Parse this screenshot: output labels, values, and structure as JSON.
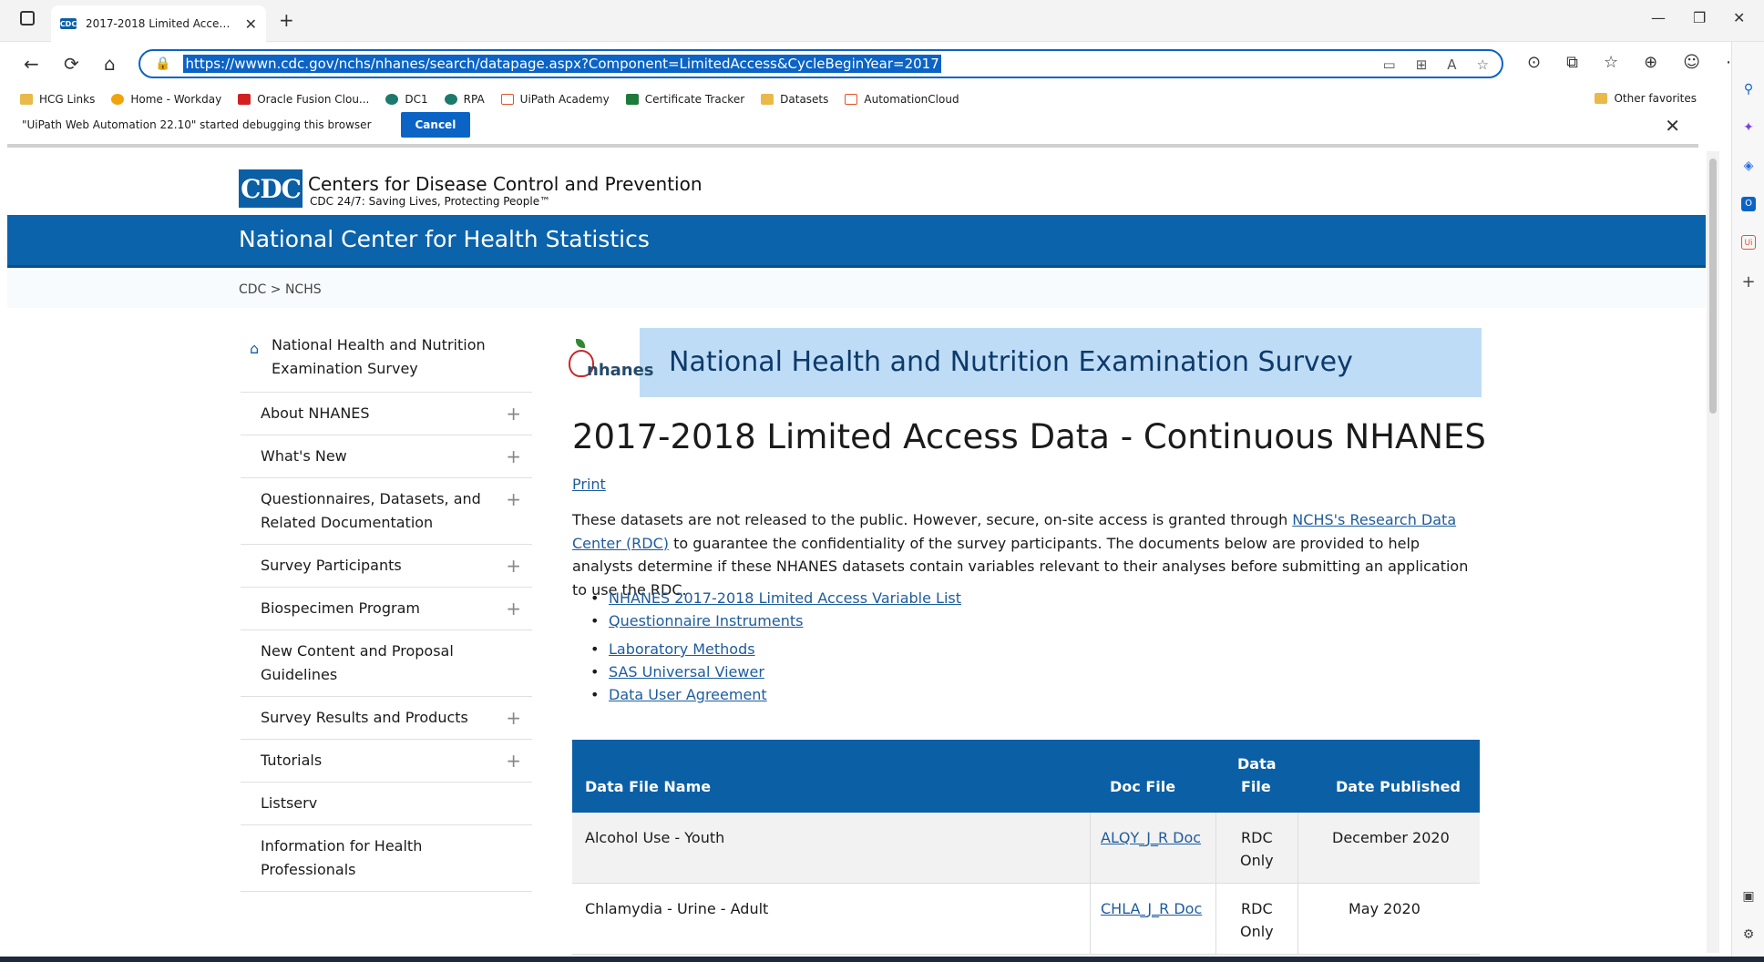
{
  "browser": {
    "tab_title": "2017-2018 Limited Access Data",
    "tab_favicon_text": "CDC",
    "url": "https://wwwn.cdc.gov/nchs/nhanes/search/datapage.aspx?Component=LimitedAccess&CycleBeginYear=2017",
    "favorites": [
      "HCG Links",
      "Home - Workday",
      "Oracle Fusion Clou...",
      "DC1",
      "RPA",
      "UiPath Academy",
      "Certificate Tracker",
      "Datasets",
      "AutomationCloud"
    ],
    "other_favorites": "Other favorites",
    "debug_message": "\"UiPath Web Automation 22.10\" started debugging this browser",
    "debug_cancel": "Cancel"
  },
  "site": {
    "logo_text": "CDC",
    "org_name": "Centers for Disease Control and Prevention",
    "tagline": "CDC 24/7: Saving Lives, Protecting People™",
    "banner_title": "National Center for Health Statistics",
    "breadcrumb": "CDC > NCHS"
  },
  "sidebar": {
    "top": "National Health and Nutrition Examination Survey",
    "items": [
      {
        "label": "About NHANES",
        "plus": "+"
      },
      {
        "label": "What's New",
        "plus": "+"
      },
      {
        "label": "Questionnaires, Datasets, and Related Documentation",
        "plus": "+"
      },
      {
        "label": "Survey Participants",
        "plus": "+"
      },
      {
        "label": "Biospecimen Program",
        "plus": "+"
      },
      {
        "label": "New Content and Proposal Guidelines",
        "plus": ""
      },
      {
        "label": "Survey Results and Products",
        "plus": "+"
      },
      {
        "label": "Tutorials",
        "plus": "+"
      },
      {
        "label": "Listserv",
        "plus": ""
      },
      {
        "label": "Information for Health Professionals",
        "plus": ""
      }
    ]
  },
  "nhanes": {
    "logo_text": "nhanes",
    "banner_title": "National Health and Nutrition Examination Survey"
  },
  "main": {
    "title": "2017-2018 Limited Access Data - Continuous NHANES",
    "print": "Print",
    "desc_before": "These datasets are not released to the public. However, secure, on-site access is granted through ",
    "desc_link": "NCHS's Research Data Center (RDC)",
    "desc_after": " to guarantee the confidentiality of the survey participants. The documents below are provided to help analysts determine if these NHANES datasets contain variables relevant to their analyses before submitting an application to use the RDC.",
    "links": [
      "NHANES 2017-2018 Limited Access Variable List",
      "Questionnaire Instruments",
      "Laboratory Methods",
      "SAS Universal Viewer",
      "Data User Agreement"
    ]
  },
  "table": {
    "headers": {
      "name": "Data File Name",
      "doc": "Doc File",
      "data_line1": "Data",
      "data_line2": "File",
      "date": "Date Published"
    },
    "rows": [
      {
        "name": "Alcohol Use - Youth",
        "doc": "ALQY_J_R Doc",
        "data_line1": "RDC",
        "data_line2": "Only",
        "date": "December 2020"
      },
      {
        "name": "Chlamydia - Urine - Adult",
        "doc": "CHLA_J_R Doc",
        "data_line1": "RDC",
        "data_line2": "Only",
        "date": "May 2020"
      }
    ]
  }
}
